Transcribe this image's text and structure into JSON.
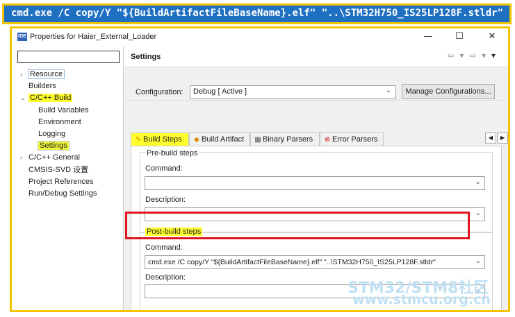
{
  "banner": {
    "command": "cmd.exe /C copy/Y  \"${BuildArtifactFileBaseName}.elf\" \"..\\STM32H750_IS25LP128F.stldr\""
  },
  "window": {
    "app_icon": "IDE",
    "title": "Properties for Haier_External_Loader",
    "minimize": "—",
    "maximize": "☐",
    "close": "✕"
  },
  "filter": {
    "value": ""
  },
  "tree": {
    "items": [
      {
        "label": "Resource",
        "arrow": "›",
        "highlight": "selected-blue"
      },
      {
        "label": "Builders",
        "arrow": ""
      },
      {
        "label": "C/C++ Build",
        "arrow": "⌄",
        "highlight": "yellow"
      },
      {
        "label": "Build Variables",
        "child": true
      },
      {
        "label": "Environment",
        "child": true
      },
      {
        "label": "Logging",
        "child": true
      },
      {
        "label": "Settings",
        "child": true,
        "highlight": "yellow-selected"
      },
      {
        "label": "C/C++ General",
        "arrow": "›"
      },
      {
        "label": "CMSIS-SVD 设置",
        "arrow": ""
      },
      {
        "label": "Project References",
        "arrow": ""
      },
      {
        "label": "Run/Debug Settings",
        "arrow": ""
      }
    ]
  },
  "settings": {
    "title": "Settings",
    "nav": {
      "back": "⇦",
      "back_menu": "▾",
      "forward": "⇨",
      "forward_menu": "▾",
      "view_menu": "▾"
    }
  },
  "configuration": {
    "label": "Configuration:",
    "value": "Debug  [ Active ]",
    "manage_label": "Manage Configurations..."
  },
  "tabs": [
    {
      "label": "Build Steps",
      "icon": "build-steps-icon",
      "glyph": "✎",
      "active": true
    },
    {
      "label": "Build Artifact",
      "icon": "build-artifact-icon",
      "glyph": "◆"
    },
    {
      "label": "Binary Parsers",
      "icon": "binary-parsers-icon",
      "glyph": "▦"
    },
    {
      "label": "Error Parsers",
      "icon": "error-parsers-icon",
      "glyph": "⊗"
    }
  ],
  "tab_scroll": {
    "left": "◀",
    "right": "▶"
  },
  "pre_build": {
    "title": "Pre-build steps",
    "command_label": "Command:",
    "command_value": "",
    "description_label": "Description:",
    "description_value": ""
  },
  "post_build": {
    "title": "Post-build steps",
    "command_label": "Command:",
    "command_value": "cmd.exe /C copy/Y  \"${BuildArtifactFileBaseName}.elf\" \"..\\STM32H750_IS25LP128F.stldr\"",
    "description_label": "Description:",
    "description_value": ""
  },
  "watermark": {
    "line1": "STM32/STM8社区",
    "line2": "www.stmcu.org.cn"
  },
  "colors": {
    "accent_yellow": "#f5c400",
    "highlight_yellow": "#ffff2e",
    "banner_blue": "#1f6fc2",
    "annotation_red": "#e0141c"
  }
}
